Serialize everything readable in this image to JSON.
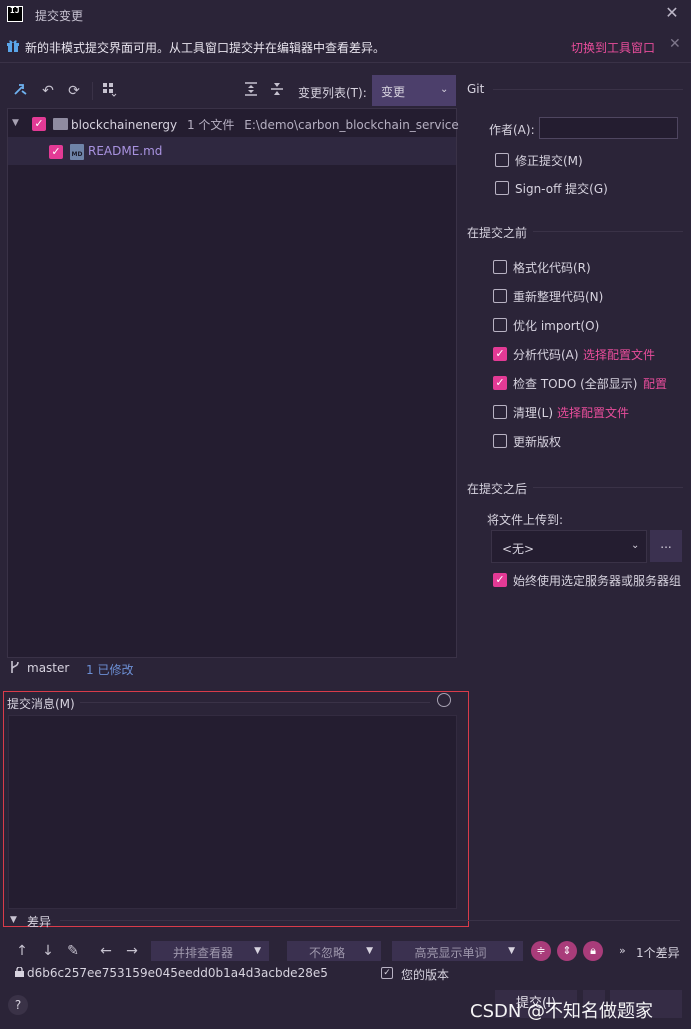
{
  "window": {
    "logo": "IJ",
    "title": "提交变更"
  },
  "banner": {
    "text": "新的非模式提交界面可用。从工具窗口提交并在编辑器中查看差异。",
    "link": "切换到工具窗口"
  },
  "changes_toolbar": {
    "group_by_label": "变更列表(T):",
    "group_by_value": "变更"
  },
  "tree": {
    "root": {
      "name": "blockchainenergy",
      "count": "1 个文件",
      "path": "E:\\demo\\carbon_blockchain_service"
    },
    "file": {
      "name": "README.md"
    }
  },
  "status": {
    "branch": "master",
    "modified": "1 已修改"
  },
  "commit": {
    "label": "提交消息(M)",
    "message": ""
  },
  "diff": {
    "label": "差异",
    "viewer": "并排查看器",
    "ignore": "不忽略",
    "highlight": "高亮显示单词",
    "count": "1个差异",
    "hash": "d6b6c257ee753159e045eedd0b1a4d3acbde28e5",
    "your_version": "您的版本"
  },
  "right_panel": {
    "git_header": "Git",
    "author_label": "作者(A):",
    "author_value": "",
    "amend": "修正提交(M)",
    "signoff": "Sign-off 提交(G)",
    "before_header": "在提交之前",
    "reformat": "格式化代码(R)",
    "rearrange": "重新整理代码(N)",
    "optimize": "优化 import(O)",
    "analyze": "分析代码(A)",
    "analyze_link": "选择配置文件",
    "todo": "检查 TODO (全部显示)",
    "todo_link": "配置",
    "cleanup": "清理(L)",
    "cleanup_link": "选择配置文件",
    "copyright": "更新版权",
    "after_header": "在提交之后",
    "upload_label": "将文件上传到:",
    "upload_value": "<无>",
    "ellipsis": "...",
    "always_use": "始终使用选定服务器或服务器组"
  },
  "footer": {
    "help": "?",
    "commit_btn": "提交(I)",
    "watermark": "CSDN @不知名做题家"
  },
  "colors": {
    "accent": "#e33a95",
    "link": "#e84d9b",
    "background": "#2b2438"
  }
}
